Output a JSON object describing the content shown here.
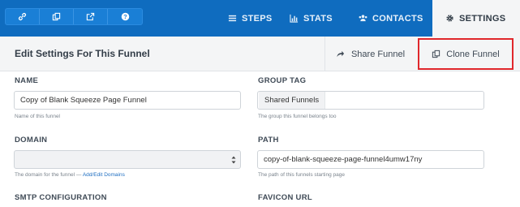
{
  "colors": {
    "nav_bg": "#0f6cbf",
    "highlight_border": "#e0272c",
    "link": "#1f6fc2"
  },
  "icon_toolbar": [
    {
      "icon": "link-icon"
    },
    {
      "icon": "copy-icon"
    },
    {
      "icon": "external-link-icon"
    },
    {
      "icon": "help-icon"
    }
  ],
  "nav": {
    "steps": "STEPS",
    "stats": "STATS",
    "contacts": "CONTACTS",
    "settings": "SETTINGS"
  },
  "header": {
    "title": "Edit Settings For This Funnel",
    "share_label": "Share Funnel",
    "clone_label": "Clone Funnel"
  },
  "form": {
    "name": {
      "label": "NAME",
      "value": "Copy of Blank Squeeze Page Funnel",
      "help": "Name of this funnel"
    },
    "group_tag": {
      "label": "GROUP TAG",
      "value": "Shared Funnels",
      "help": "The group this funnel belongs too"
    },
    "domain": {
      "label": "DOMAIN",
      "value": "",
      "help": "The domain for the funnel — ",
      "help_link": "Add/Edit Domains"
    },
    "path": {
      "label": "PATH",
      "value": "copy-of-blank-squeeze-page-funnel4umw17ny",
      "help": "The path of this funnels starting page"
    },
    "smtp": {
      "label": "SMTP CONFIGURATION"
    },
    "favicon": {
      "label": "FAVICON URL"
    }
  }
}
